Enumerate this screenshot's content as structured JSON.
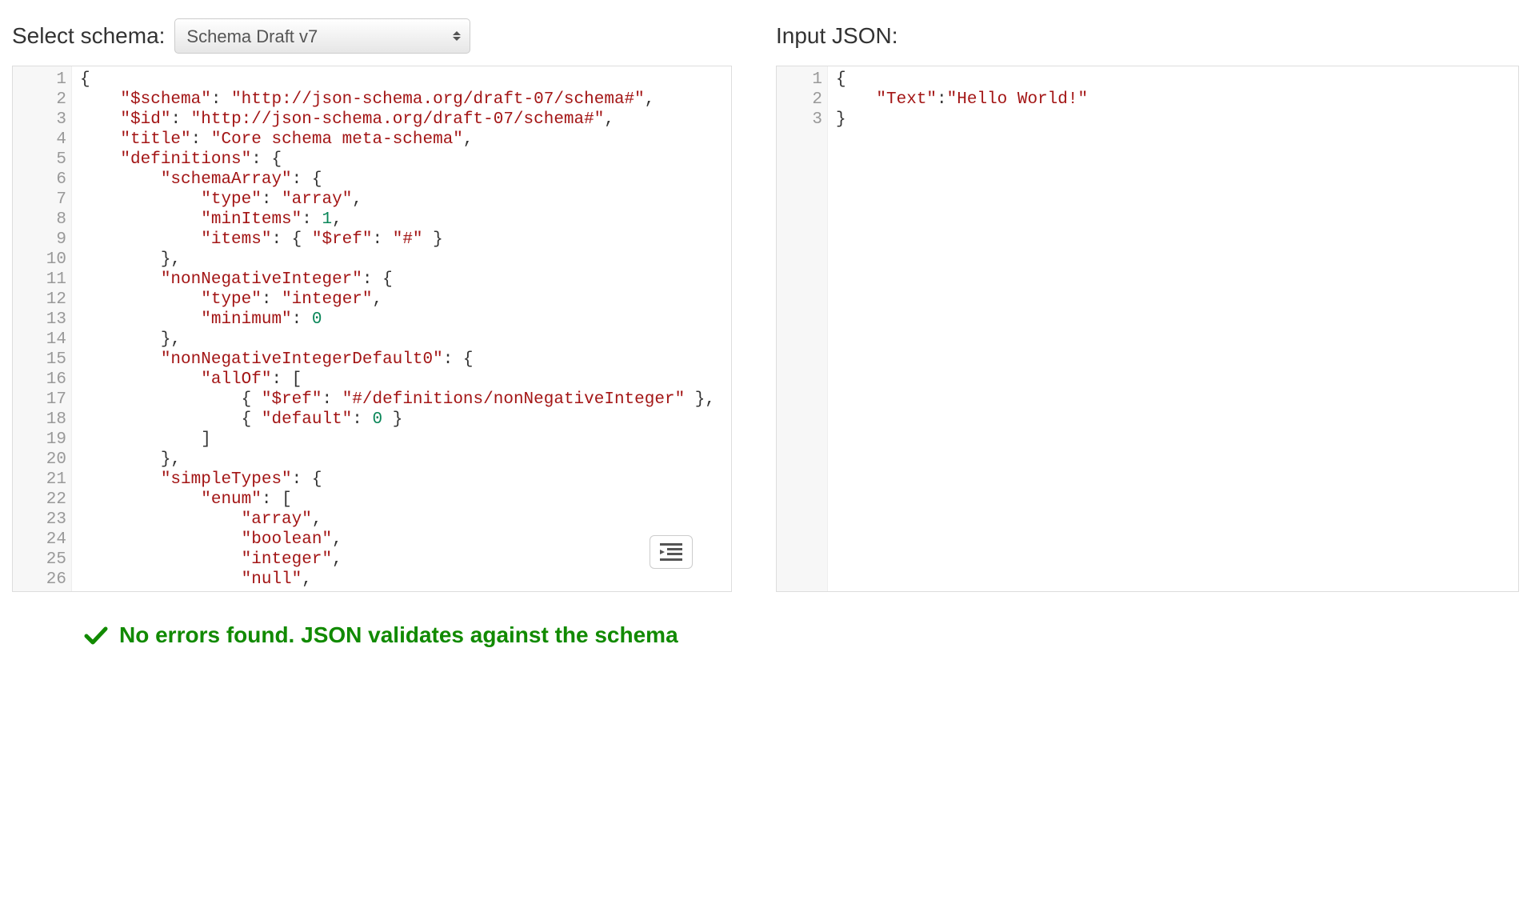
{
  "left": {
    "label": "Select schema:",
    "selected_option": "Schema Draft v7",
    "gutter_lines": [
      "1",
      "2",
      "3",
      "4",
      "5",
      "6",
      "7",
      "8",
      "9",
      "10",
      "11",
      "12",
      "13",
      "14",
      "15",
      "16",
      "17",
      "18",
      "19",
      "20",
      "21",
      "22",
      "23",
      "24",
      "25",
      "26"
    ],
    "code_lines": [
      [
        [
          "punc",
          "{"
        ]
      ],
      [
        [
          "indent",
          4
        ],
        [
          "key",
          "\"$schema\""
        ],
        [
          "punc",
          ": "
        ],
        [
          "str",
          "\"http://json-schema.org/draft-07/schema#\""
        ],
        [
          "punc",
          ","
        ]
      ],
      [
        [
          "indent",
          4
        ],
        [
          "key",
          "\"$id\""
        ],
        [
          "punc",
          ": "
        ],
        [
          "str",
          "\"http://json-schema.org/draft-07/schema#\""
        ],
        [
          "punc",
          ","
        ]
      ],
      [
        [
          "indent",
          4
        ],
        [
          "key",
          "\"title\""
        ],
        [
          "punc",
          ": "
        ],
        [
          "str",
          "\"Core schema meta-schema\""
        ],
        [
          "punc",
          ","
        ]
      ],
      [
        [
          "indent",
          4
        ],
        [
          "key",
          "\"definitions\""
        ],
        [
          "punc",
          ": {"
        ]
      ],
      [
        [
          "indent",
          8
        ],
        [
          "key",
          "\"schemaArray\""
        ],
        [
          "punc",
          ": {"
        ]
      ],
      [
        [
          "indent",
          12
        ],
        [
          "key",
          "\"type\""
        ],
        [
          "punc",
          ": "
        ],
        [
          "str",
          "\"array\""
        ],
        [
          "punc",
          ","
        ]
      ],
      [
        [
          "indent",
          12
        ],
        [
          "key",
          "\"minItems\""
        ],
        [
          "punc",
          ": "
        ],
        [
          "num",
          "1"
        ],
        [
          "punc",
          ","
        ]
      ],
      [
        [
          "indent",
          12
        ],
        [
          "key",
          "\"items\""
        ],
        [
          "punc",
          ": { "
        ],
        [
          "key",
          "\"$ref\""
        ],
        [
          "punc",
          ": "
        ],
        [
          "str",
          "\"#\""
        ],
        [
          "punc",
          " }"
        ]
      ],
      [
        [
          "indent",
          8
        ],
        [
          "punc",
          "},"
        ]
      ],
      [
        [
          "indent",
          8
        ],
        [
          "key",
          "\"nonNegativeInteger\""
        ],
        [
          "punc",
          ": {"
        ]
      ],
      [
        [
          "indent",
          12
        ],
        [
          "key",
          "\"type\""
        ],
        [
          "punc",
          ": "
        ],
        [
          "str",
          "\"integer\""
        ],
        [
          "punc",
          ","
        ]
      ],
      [
        [
          "indent",
          12
        ],
        [
          "key",
          "\"minimum\""
        ],
        [
          "punc",
          ": "
        ],
        [
          "num",
          "0"
        ]
      ],
      [
        [
          "indent",
          8
        ],
        [
          "punc",
          "},"
        ]
      ],
      [
        [
          "indent",
          8
        ],
        [
          "key",
          "\"nonNegativeIntegerDefault0\""
        ],
        [
          "punc",
          ": {"
        ]
      ],
      [
        [
          "indent",
          12
        ],
        [
          "key",
          "\"allOf\""
        ],
        [
          "punc",
          ": ["
        ]
      ],
      [
        [
          "indent",
          16
        ],
        [
          "punc",
          "{ "
        ],
        [
          "key",
          "\"$ref\""
        ],
        [
          "punc",
          ": "
        ],
        [
          "str",
          "\"#/definitions/nonNegativeInteger\""
        ],
        [
          "punc",
          " },"
        ]
      ],
      [
        [
          "indent",
          16
        ],
        [
          "punc",
          "{ "
        ],
        [
          "key",
          "\"default\""
        ],
        [
          "punc",
          ": "
        ],
        [
          "num",
          "0"
        ],
        [
          "punc",
          " }"
        ]
      ],
      [
        [
          "indent",
          12
        ],
        [
          "punc",
          "]"
        ]
      ],
      [
        [
          "indent",
          8
        ],
        [
          "punc",
          "},"
        ]
      ],
      [
        [
          "indent",
          8
        ],
        [
          "key",
          "\"simpleTypes\""
        ],
        [
          "punc",
          ": {"
        ]
      ],
      [
        [
          "indent",
          12
        ],
        [
          "key",
          "\"enum\""
        ],
        [
          "punc",
          ": ["
        ]
      ],
      [
        [
          "indent",
          16
        ],
        [
          "str",
          "\"array\""
        ],
        [
          "punc",
          ","
        ]
      ],
      [
        [
          "indent",
          16
        ],
        [
          "str",
          "\"boolean\""
        ],
        [
          "punc",
          ","
        ]
      ],
      [
        [
          "indent",
          16
        ],
        [
          "str",
          "\"integer\""
        ],
        [
          "punc",
          ","
        ]
      ],
      [
        [
          "indent",
          16
        ],
        [
          "str",
          "\"null\""
        ],
        [
          "punc",
          ","
        ]
      ]
    ]
  },
  "right": {
    "label": "Input JSON:",
    "gutter_lines": [
      "1",
      "2",
      "3"
    ],
    "code_lines": [
      [
        [
          "punc",
          "{"
        ]
      ],
      [
        [
          "indent",
          4
        ],
        [
          "key",
          "\"Text\""
        ],
        [
          "punc",
          ":"
        ],
        [
          "str",
          "\"Hello World!\""
        ]
      ],
      [
        [
          "punc",
          "}"
        ]
      ]
    ]
  },
  "status": {
    "text": "No errors found. JSON validates against the schema"
  }
}
